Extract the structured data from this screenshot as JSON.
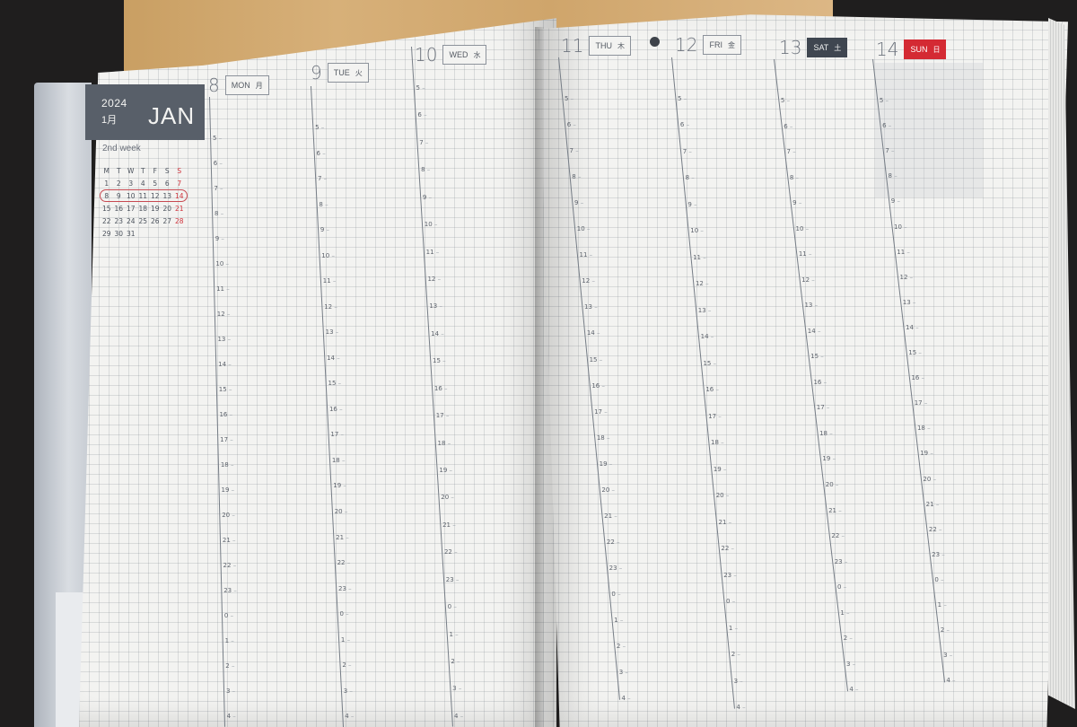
{
  "planner": {
    "year": "2024",
    "month_jp": "1月",
    "month_name": "JAN",
    "week_label": "2nd week"
  },
  "mini_calendar": {
    "weekday_headers": [
      "M",
      "T",
      "W",
      "T",
      "F",
      "S",
      "S"
    ],
    "weeks": [
      [
        "1",
        "2",
        "3",
        "4",
        "5",
        "6",
        "7"
      ],
      [
        "8",
        "9",
        "10",
        "11",
        "12",
        "13",
        "14"
      ],
      [
        "15",
        "16",
        "17",
        "18",
        "19",
        "20",
        "21"
      ],
      [
        "22",
        "23",
        "24",
        "25",
        "26",
        "27",
        "28"
      ],
      [
        "29",
        "30",
        "31",
        "",
        "",
        "",
        ""
      ]
    ],
    "highlighted_week": "2",
    "sunday_color": "#d0333c"
  },
  "days": [
    {
      "num": "8",
      "en": "MON",
      "jp": "月",
      "style": "plain"
    },
    {
      "num": "9",
      "en": "TUE",
      "jp": "火",
      "style": "plain"
    },
    {
      "num": "10",
      "en": "WED",
      "jp": "水",
      "style": "plain"
    },
    {
      "num": "11",
      "en": "THU",
      "jp": "木",
      "style": "plain"
    },
    {
      "num": "12",
      "en": "FRI",
      "jp": "金",
      "style": "plain"
    },
    {
      "num": "13",
      "en": "SAT",
      "jp": "土",
      "style": "sat"
    },
    {
      "num": "14",
      "en": "SUN",
      "jp": "日",
      "style": "sun"
    }
  ],
  "hour_labels": [
    "5",
    "6",
    "7",
    "8",
    "9",
    "10",
    "11",
    "12",
    "13",
    "14",
    "15",
    "16",
    "17",
    "18",
    "19",
    "20",
    "21",
    "22",
    "23",
    "0",
    "1",
    "2",
    "3",
    "4"
  ],
  "colors": {
    "header_dark": "#585f69",
    "saturday": "#3f4650",
    "sunday": "#d42a33",
    "paper": "#f3f3f1",
    "grid": "#78808a"
  },
  "icons": {
    "new_moon": "moon-phase-icon"
  }
}
